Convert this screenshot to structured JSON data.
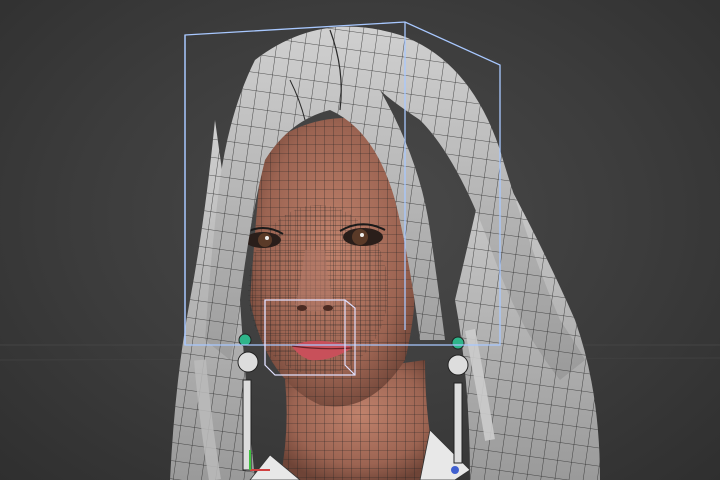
{
  "viewport": {
    "background_color": "#3a3a3a",
    "shading": "smooth-with-wireframe",
    "selection_box_color": "#a8c8ff",
    "subject": "character-head-model"
  },
  "model": {
    "hair_color": "#bdbdbd",
    "skin_color": "#a8705d",
    "lip_color": "#c8505a",
    "wire_color": "#1a1a1a",
    "earring_accent_color": "#2fb58a",
    "shirt_color": "#e8e8e8"
  },
  "gizmo": {
    "x_axis_color": "#d04040",
    "y_axis_color": "#40c040",
    "z_axis_color": "#4060d0"
  }
}
